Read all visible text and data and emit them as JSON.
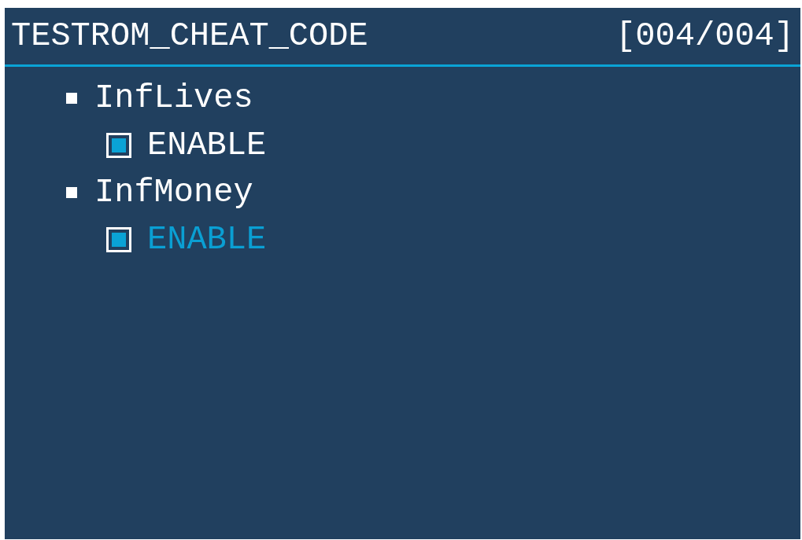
{
  "header": {
    "title": "TESTROM_CHEAT_CODE",
    "counter": "[004/004]"
  },
  "cheats": [
    {
      "name": "InfLives",
      "options": [
        {
          "label": "ENABLE",
          "checked": true,
          "selected": false
        }
      ]
    },
    {
      "name": "InfMoney",
      "options": [
        {
          "label": "ENABLE",
          "checked": true,
          "selected": true
        }
      ]
    }
  ]
}
